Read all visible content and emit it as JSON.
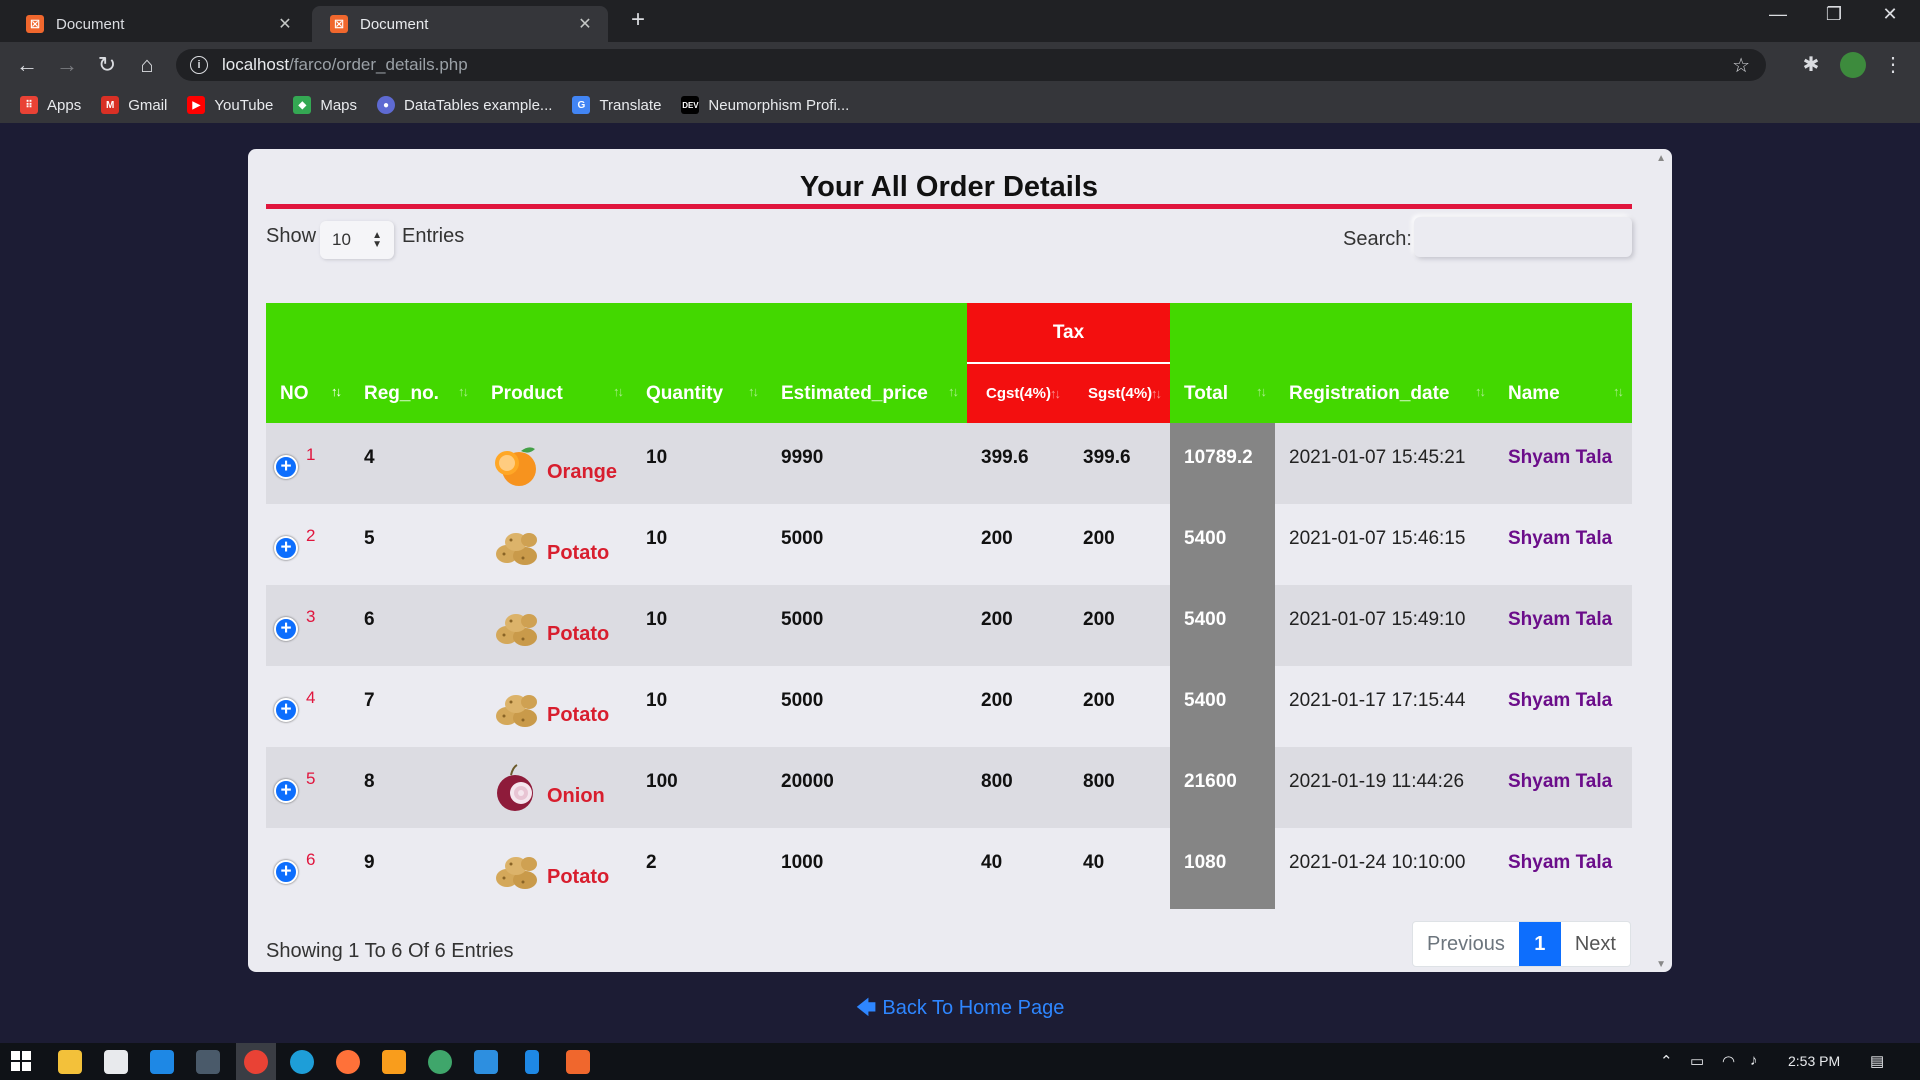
{
  "browser": {
    "tabs": [
      {
        "title": "Document",
        "close": "✕",
        "favicon": "xampp-icon"
      },
      {
        "title": "Document",
        "close": "✕",
        "favicon": "xampp-icon"
      }
    ],
    "new_tab": "+",
    "window_controls": {
      "minimize": "—",
      "maximize": "❐",
      "close": "✕"
    },
    "nav": {
      "back": "←",
      "forward": "→",
      "reload": "↻",
      "home": "⌂"
    },
    "url_host": "localhost",
    "url_path": "/farco/order_details.php",
    "bookmarks": [
      {
        "label": "Apps",
        "icon": "apps-grid-icon",
        "color": "#e94235"
      },
      {
        "label": "Gmail",
        "icon": "gmail-icon",
        "color": "#d93025"
      },
      {
        "label": "YouTube",
        "icon": "youtube-icon",
        "color": "#ff0000"
      },
      {
        "label": "Maps",
        "icon": "maps-icon",
        "color": "#34a853"
      },
      {
        "label": "DataTables example...",
        "icon": "datatables-icon",
        "color": "#5e6ad2"
      },
      {
        "label": "Translate",
        "icon": "translate-icon",
        "color": "#4285f4"
      },
      {
        "label": "Neumorphism Profi...",
        "icon": "dev-icon",
        "color": "#000000"
      }
    ]
  },
  "page": {
    "title": "Your All Order Details",
    "show_label": "Show",
    "entries_label": "Entries",
    "page_length": "10",
    "search_label": "Search:",
    "search_value": "",
    "columns": {
      "no": "NO",
      "reg_no": "Reg_no.",
      "product": "Product",
      "quantity": "Quantity",
      "estimated_price": "Estimated_price",
      "tax": "Tax",
      "cgst": "Cgst(4%)",
      "sgst": "Sgst(4%)",
      "total": "Total",
      "registration_date": "Registration_date",
      "name": "Name"
    },
    "sort_icon": "↑↓",
    "expand_icon": "+",
    "rows": [
      {
        "no": "1",
        "reg_no": "4",
        "product": "Orange",
        "product_icon": "orange-fruit-icon",
        "quantity": "10",
        "estimated_price": "9990",
        "cgst": "399.6",
        "sgst": "399.6",
        "total": "10789.2",
        "date": "2021-01-07 15:45:21",
        "name": "Shyam Tala"
      },
      {
        "no": "2",
        "reg_no": "5",
        "product": "Potato",
        "product_icon": "potato-icon",
        "quantity": "10",
        "estimated_price": "5000",
        "cgst": "200",
        "sgst": "200",
        "total": "5400",
        "date": "2021-01-07 15:46:15",
        "name": "Shyam Tala"
      },
      {
        "no": "3",
        "reg_no": "6",
        "product": "Potato",
        "product_icon": "potato-icon",
        "quantity": "10",
        "estimated_price": "5000",
        "cgst": "200",
        "sgst": "200",
        "total": "5400",
        "date": "2021-01-07 15:49:10",
        "name": "Shyam Tala"
      },
      {
        "no": "4",
        "reg_no": "7",
        "product": "Potato",
        "product_icon": "potato-icon",
        "quantity": "10",
        "estimated_price": "5000",
        "cgst": "200",
        "sgst": "200",
        "total": "5400",
        "date": "2021-01-17 17:15:44",
        "name": "Shyam Tala"
      },
      {
        "no": "5",
        "reg_no": "8",
        "product": "Onion",
        "product_icon": "onion-icon",
        "quantity": "100",
        "estimated_price": "20000",
        "cgst": "800",
        "sgst": "800",
        "total": "21600",
        "date": "2021-01-19 11:44:26",
        "name": "Shyam Tala"
      },
      {
        "no": "6",
        "reg_no": "9",
        "product": "Potato",
        "product_icon": "potato-icon",
        "quantity": "2",
        "estimated_price": "1000",
        "cgst": "40",
        "sgst": "40",
        "total": "1080",
        "date": "2021-01-24 10:10:00",
        "name": "Shyam Tala"
      }
    ],
    "info": "Showing 1 To 6 Of 6 Entries",
    "pagination": {
      "previous": "Previous",
      "current": "1",
      "next": "Next"
    },
    "back_link": "Back To Home Page",
    "colors": {
      "header_green": "#43d800",
      "tax_red": "#f30f0f",
      "title_rule": "#e0153d",
      "total_bg": "#858585",
      "link_blue": "#2e86ff"
    }
  },
  "taskbar": {
    "clock": "2:53 PM",
    "apps": [
      "windows-start-icon",
      "file-explorer-icon",
      "store-icon",
      "mail-icon",
      "media-icon",
      "chrome-icon",
      "edge-icon",
      "firefox-icon",
      "sublime-icon",
      "chat-icon",
      "vscode-icon",
      "phone-icon",
      "xampp-icon"
    ]
  }
}
